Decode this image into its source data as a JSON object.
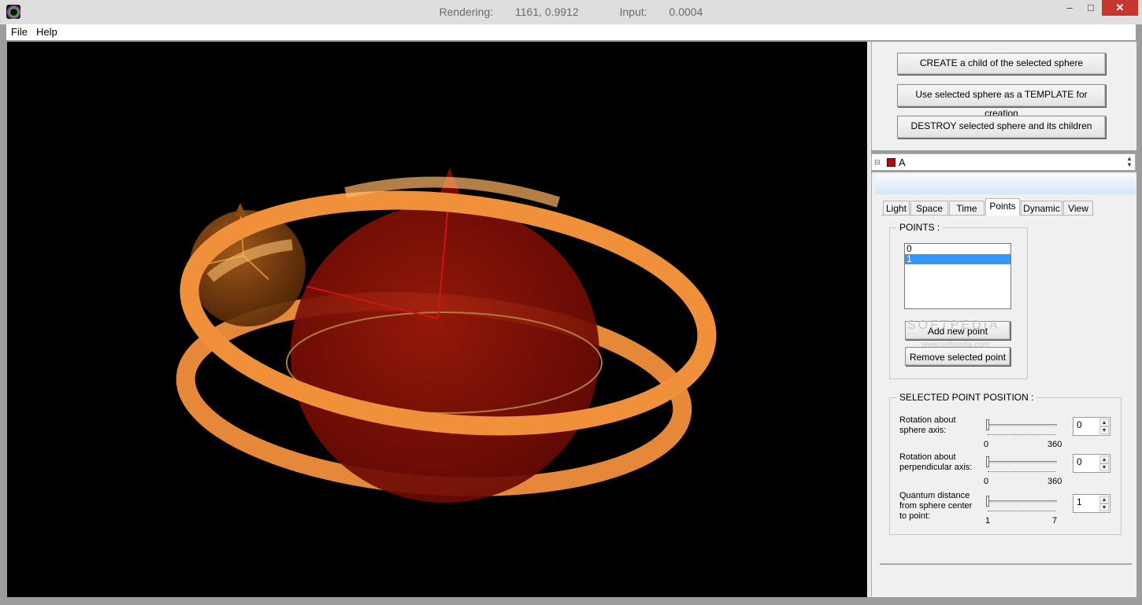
{
  "window": {
    "rendering_label": "Rendering:",
    "rendering_value": "1161, 0.9912",
    "input_label": "Input:",
    "input_value": "0.0004",
    "min_glyph": "–",
    "max_glyph": "□",
    "close_glyph": "✕"
  },
  "menu": {
    "file": "File",
    "help": "Help"
  },
  "actions": {
    "create": "CREATE a child of the selected sphere",
    "template": "Use selected sphere as a TEMPLATE for creation",
    "destroy": "DESTROY selected sphere and its children"
  },
  "tree": {
    "expander": "⊟",
    "selected": "A",
    "swatch_color": "#a01010"
  },
  "tabs": [
    "Light",
    "Space",
    "Time",
    "Points",
    "Dynamic",
    "View"
  ],
  "active_tab": "Points",
  "points": {
    "title": "POINTS :",
    "items": [
      "0",
      "1"
    ],
    "selected_index": 1,
    "add": "Add new point",
    "remove": "Remove selected point"
  },
  "position": {
    "title": "SELECTED POINT POSITION :",
    "rotation_axis": {
      "label_line1": "Rotation about",
      "label_line2": "sphere axis:",
      "min": "0",
      "max": "360",
      "value": "0"
    },
    "rotation_perp": {
      "label_line1": "Rotation about",
      "label_line2": "perpendicular axis:",
      "min": "0",
      "max": "360",
      "value": "0"
    },
    "quantum": {
      "label_line1": "Quantum distance",
      "label_line2": "from sphere center",
      "label_line3": "to point:",
      "min": "1",
      "max": "7",
      "value": "1"
    }
  },
  "watermark": {
    "line1": "SOFTPEDIA",
    "line2": "www.softpedia.com"
  },
  "colors": {
    "sphere": "#8a1408",
    "ring": "#f0903a",
    "axis": "#d01414",
    "selection": "#3399ff"
  }
}
